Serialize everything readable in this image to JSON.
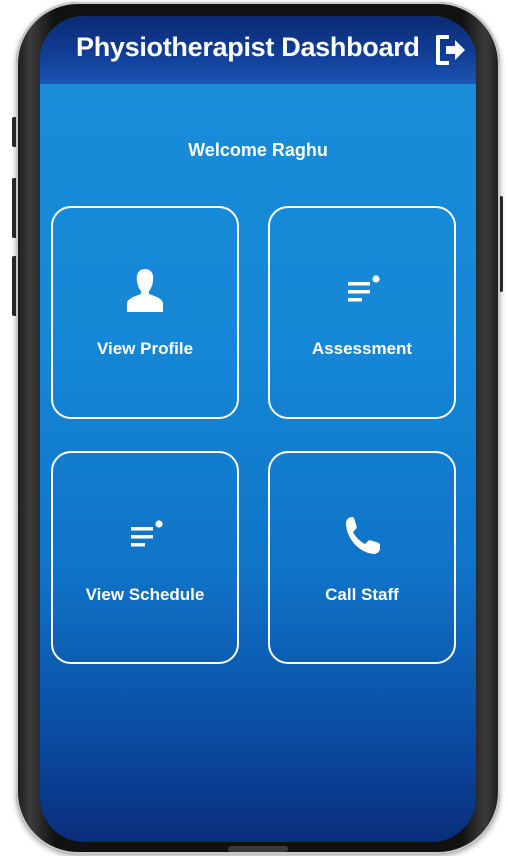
{
  "app_bar": {
    "title": "Physiotherapist Dashboard",
    "logout_icon": "logout-icon"
  },
  "welcome_text": "Welcome Raghu",
  "cards": [
    {
      "label": "View Profile",
      "icon": "person-icon"
    },
    {
      "label": "Assessment",
      "icon": "list-icon"
    },
    {
      "label": "View Schedule",
      "icon": "list-icon"
    },
    {
      "label": "Call Staff",
      "icon": "phone-icon"
    }
  ],
  "colors": {
    "app_bar": "#123f98",
    "background_top": "#1a8ed9",
    "background_bottom": "#0a2d7c",
    "text": "#ffffff"
  }
}
